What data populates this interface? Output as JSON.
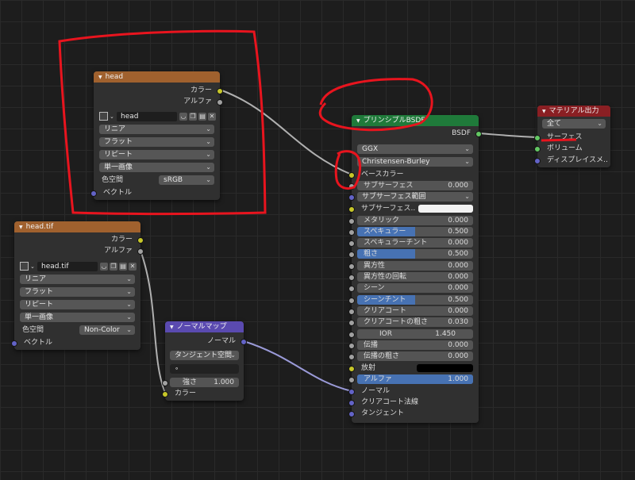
{
  "node_head": {
    "title": "head",
    "outputs": [
      "カラー",
      "アルファ"
    ],
    "image_name": "head",
    "interpolation": "リニア",
    "projection": "フラット",
    "extension": "リピート",
    "source": "単一画像",
    "colorspace_label": "色空間",
    "colorspace": "sRGB",
    "input_vector": "ベクトル"
  },
  "node_headtif": {
    "title": "head.tif",
    "outputs": [
      "カラー",
      "アルファ"
    ],
    "image_name": "head.tif",
    "interpolation": "リニア",
    "projection": "フラット",
    "extension": "リピート",
    "source": "単一画像",
    "colorspace_label": "色空間",
    "colorspace": "Non-Color",
    "input_vector": "ベクトル"
  },
  "node_normalmap": {
    "title": "ノーマルマップ",
    "output": "ノーマル",
    "space": "タンジェント空間",
    "uvmap": "",
    "strength_label": "強さ",
    "strength": "1.000",
    "input_color": "カラー"
  },
  "node_bsdf": {
    "title": "プリンシプルBSDF",
    "output": "BSDF",
    "distribution": "GGX",
    "subsurface_method": "Christensen-Burley",
    "base_color": "ベースカラー",
    "subsurface": {
      "label": "サブサーフェス",
      "value": "0.000"
    },
    "subsurface_radius": "サブサーフェス範囲",
    "subsurface_color": "サブサーフェス..",
    "metallic": {
      "label": "メタリック",
      "value": "0.000"
    },
    "specular": {
      "label": "スペキュラー",
      "value": "0.500",
      "fill": 0.5
    },
    "specular_tint": {
      "label": "スペキュラーチント",
      "value": "0.000"
    },
    "roughness": {
      "label": "粗さ",
      "value": "0.500",
      "fill": 0.5
    },
    "anisotropic": {
      "label": "異方性",
      "value": "0.000"
    },
    "anisotropic_rotation": {
      "label": "異方性の回転",
      "value": "0.000"
    },
    "sheen": {
      "label": "シーン",
      "value": "0.000"
    },
    "sheen_tint": {
      "label": "シーンチント",
      "value": "0.500",
      "fill": 0.5
    },
    "clearcoat": {
      "label": "クリアコート",
      "value": "0.000"
    },
    "clearcoat_roughness": {
      "label": "クリアコートの粗さ",
      "value": "0.030"
    },
    "ior": {
      "label": "IOR",
      "value": "1.450"
    },
    "transmission": {
      "label": "伝播",
      "value": "0.000"
    },
    "transmission_roughness": {
      "label": "伝播の粗さ",
      "value": "0.000"
    },
    "emission": "放射",
    "alpha": {
      "label": "アルファ",
      "value": "1.000",
      "fill": 1.0
    },
    "normal": "ノーマル",
    "clearcoat_normal": "クリアコート法線",
    "tangent": "タンジェント"
  },
  "node_output": {
    "title": "マテリアル出力",
    "target": "全て",
    "surface": "サーフェス",
    "volume": "ボリューム",
    "displacement": "ディスプレイスメ.."
  },
  "colors": {
    "annotation_red": "#e8141e",
    "texture_header": "#a0612e",
    "shader_header": "#1f7a3a",
    "output_header": "#8a1f23",
    "vector_header": "#5a4ab0",
    "socket_color": "#c7c729",
    "socket_gray": "#a1a1a1",
    "socket_vector": "#6363c7",
    "socket_shader": "#63c763",
    "slider_fill": "#4772b3"
  }
}
